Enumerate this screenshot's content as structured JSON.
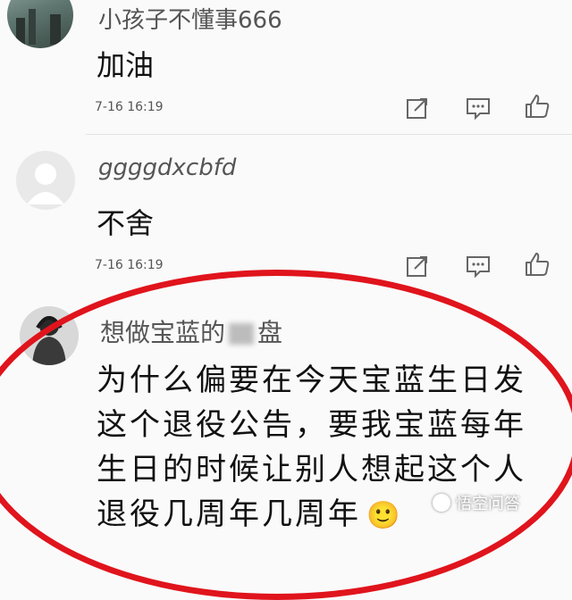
{
  "comments": [
    {
      "username": "小孩子不懂事666",
      "text": "加油",
      "time": "7-16 16:19",
      "avatar_icon": "landscape-photo-avatar"
    },
    {
      "username": "ggggdxcbfd",
      "text": "不舍",
      "time": "7-16 16:19",
      "avatar_icon": "default-user-avatar"
    },
    {
      "username": "想做宝蓝的",
      "username_tail": "盘",
      "text_lines": [
        "为什么偏要在今天宝蓝生日发",
        "这个退役公告，要我宝蓝每年",
        "生日的时候让别人想起这个人",
        "退役几周年几周年"
      ],
      "emoji": "🙂",
      "avatar_icon": "person-photo-avatar"
    }
  ],
  "actions": [
    "share-icon",
    "reply-icon",
    "like-icon"
  ],
  "watermark": "悟空问答",
  "colors": {
    "highlight": "#e0141c",
    "text": "#111111",
    "muted": "#555555",
    "icon": "#666666"
  }
}
